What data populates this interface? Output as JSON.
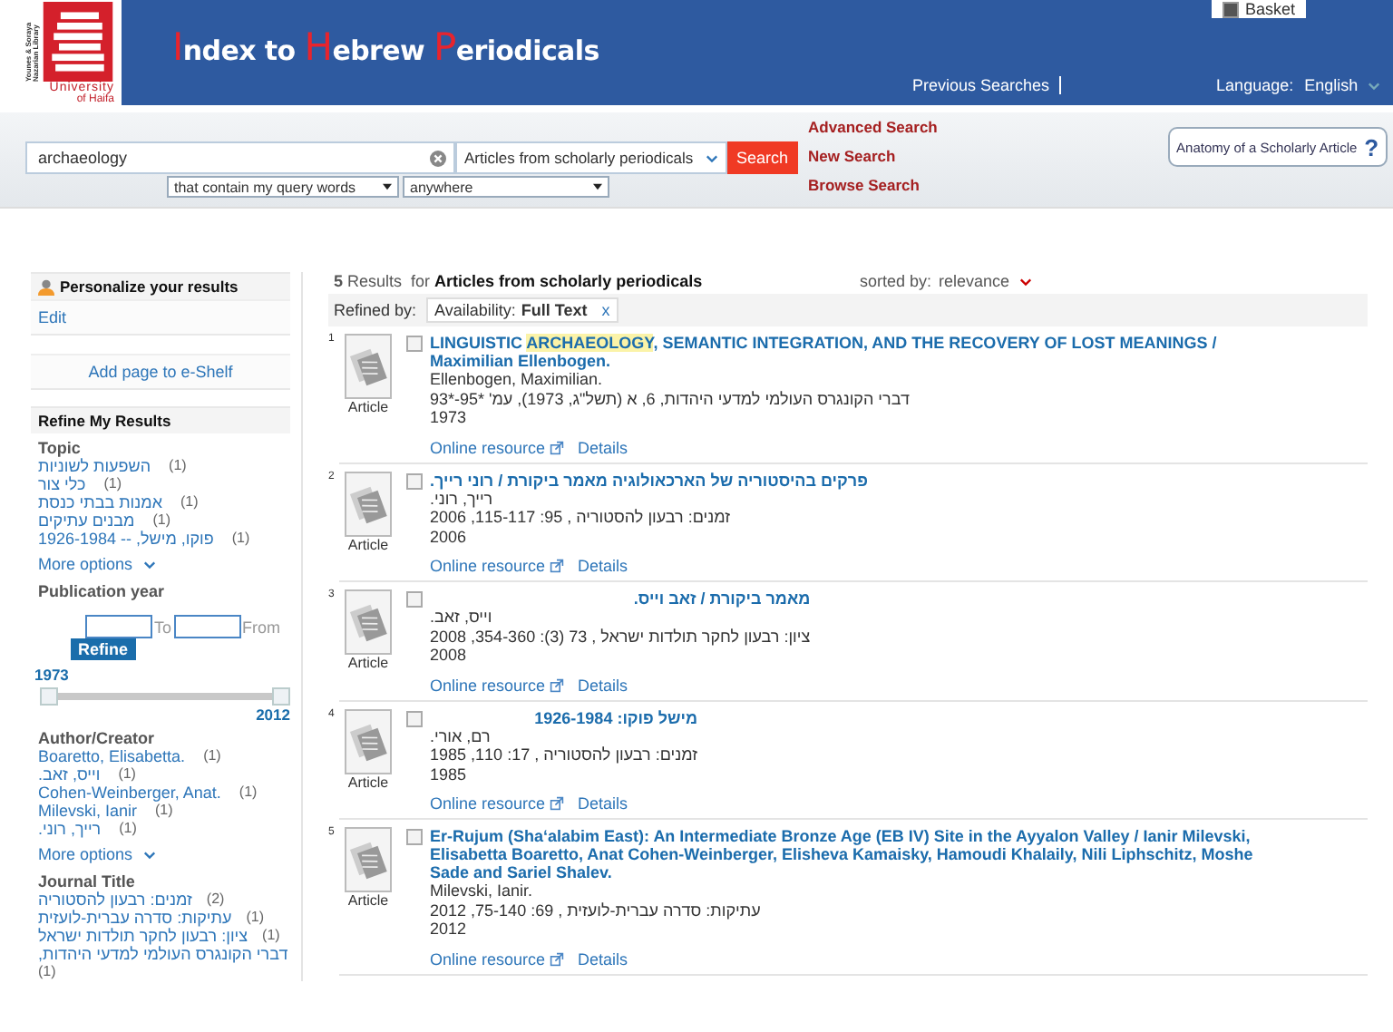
{
  "logo": {
    "vertical_text": "Younes & Soraya Nazarian Library",
    "line1": "University",
    "line2": "of Haifa"
  },
  "basket": {
    "label": "Basket",
    "checked": true
  },
  "banner": {
    "title_parts": [
      {
        "text": "I",
        "accent": true
      },
      {
        "text": "ndex to ",
        "accent": false
      },
      {
        "text": "H",
        "accent": true
      },
      {
        "text": "ebrew ",
        "accent": false
      },
      {
        "text": "P",
        "accent": true
      },
      {
        "text": "eriodicals",
        "accent": false
      }
    ],
    "previous_searches": "Previous Searches",
    "language_label": "Language:",
    "language": "English"
  },
  "search": {
    "query": "archaeology",
    "scope": "Articles from scholarly periodicals",
    "button": "Search",
    "match": "that contain my query words",
    "where": "anywhere"
  },
  "search_links": [
    "Advanced Search",
    "New Search",
    "Browse Search"
  ],
  "anatomy_button": {
    "label": "Anatomy of a Scholarly Article",
    "mark": "?"
  },
  "sidebar": {
    "personalize": {
      "title": "Personalize your results",
      "edit": "Edit"
    },
    "add_page": "Add page to e-Shelf",
    "refine_title": "Refine My Results",
    "topic": {
      "title": "Topic",
      "items": [
        {
          "label": "השפעות לשוניות",
          "count": "(1)"
        },
        {
          "label": "כלי צור",
          "count": "(1)"
        },
        {
          "label": "אמנות בבתי כנסת",
          "count": "(1)"
        },
        {
          "label": "מבנים עתיקים",
          "count": "(1)"
        },
        {
          "label": "פוקו, מישל, -- 1926-1984",
          "count": "(1)"
        }
      ],
      "more": "More options"
    },
    "year": {
      "title": "Publication year",
      "to": "To",
      "from": "From",
      "refine": "Refine",
      "min": "1973",
      "max": "2012",
      "level": 1
    },
    "author": {
      "title": "Author/Creator",
      "items": [
        {
          "label": "Boaretto, Elisabetta.",
          "count": "(1)"
        },
        {
          "label": "וייס, זאב.",
          "count": "(1)"
        },
        {
          "label": "Cohen-Weinberger, Anat.",
          "count": "(1)"
        },
        {
          "label": "Milevski, Ianir",
          "count": "(1)"
        },
        {
          "label": "רייך, רוני.",
          "count": "(1)"
        }
      ],
      "more": "More options"
    },
    "journal": {
      "title": "Journal Title",
      "items": [
        {
          "label": "זמנים: רבעון להסטוריה",
          "count": "(2)"
        },
        {
          "label": "עתיקות: סדרה עברית-לועזית",
          "count": "(1)"
        },
        {
          "label": "ציון: רבעון לחקר תולדות ישראל",
          "count": "(1)"
        },
        {
          "label": "דברי הקונגרס העולמי למדעי היהדות,",
          "count": "(1)"
        }
      ]
    }
  },
  "results_header": {
    "count": "5",
    "results_word": "Results",
    "for_word": "for",
    "scope": "Articles from scholarly periodicals",
    "sorted_label": "sorted by:",
    "sort": "relevance",
    "refined_label": "Refined by:",
    "filter_label": "Availability:",
    "filter_value": "Full Text",
    "filter_remove": "x"
  },
  "results": [
    {
      "number": "1",
      "type": "Article",
      "checked": false,
      "title_parts": [
        {
          "text": "LINGUISTIC ",
          "highlight": false
        },
        {
          "text": "ARCHAEOLOGY",
          "highlight": true
        },
        {
          "text": ", SEMANTIC INTEGRATION, AND THE RECOVERY OF LOST MEANINGS / Maximilian Ellenbogen.",
          "highlight": false
        }
      ],
      "author": "Ellenbogen, Maximilian.",
      "source": "דברי הקונגרס העולמי למדעי היהדות, 6, א (תשל\"ג, 1973), עמ' *95-*93",
      "year": "1973",
      "online": "Online resource",
      "details": "Details"
    },
    {
      "number": "2",
      "type": "Article",
      "checked": false,
      "title_parts": [
        {
          "text": "פרקים בהיסטוריה של הארכאולוגיה מאמר ביקורת / רוני רייך.",
          "highlight": false
        }
      ],
      "author": "רייך, רוני.",
      "source": "זמנים: רבעון להסטוריה , 95: 115-117, 2006",
      "year": "2006",
      "online": "Online resource",
      "details": "Details"
    },
    {
      "number": "3",
      "type": "Article",
      "checked": false,
      "title_parts": [
        {
          "text": "מאמר ביקורת / זאב וייס.",
          "highlight": false
        }
      ],
      "author": "וייס, זאב.",
      "source": "ציון: רבעון לחקר תולדות ישראל , 73 (3): 354-360, 2008",
      "year": "2008",
      "online": "Online resource",
      "details": "Details"
    },
    {
      "number": "4",
      "type": "Article",
      "checked": false,
      "title_parts": [
        {
          "text": "מישל פוקו: 1926-1984",
          "highlight": false
        }
      ],
      "author": "רם, אורי.",
      "source": "זמנים: רבעון להסטוריה , 17: 110, 1985",
      "year": "1985",
      "online": "Online resource",
      "details": "Details"
    },
    {
      "number": "5",
      "type": "Article",
      "checked": false,
      "title_parts": [
        {
          "text": "Er-Rujum (Sha‘alabim East): An Intermediate Bronze Age (EB IV) Site in the Ayyalon Valley / Ianir Milevski, Elisabetta Boaretto, Anat Cohen-Weinberger, Elisheva Kamaisky, Hamoudi Khalaily, Nili Liphschitz, Moshe Sade and Sariel Shalev.",
          "highlight": false
        }
      ],
      "author": "Milevski, Ianir.",
      "source": "עתיקות: סדרה עברית-לועזית , 69: 75-140, 2012",
      "year": "2012",
      "online": "Online resource",
      "details": "Details"
    }
  ]
}
